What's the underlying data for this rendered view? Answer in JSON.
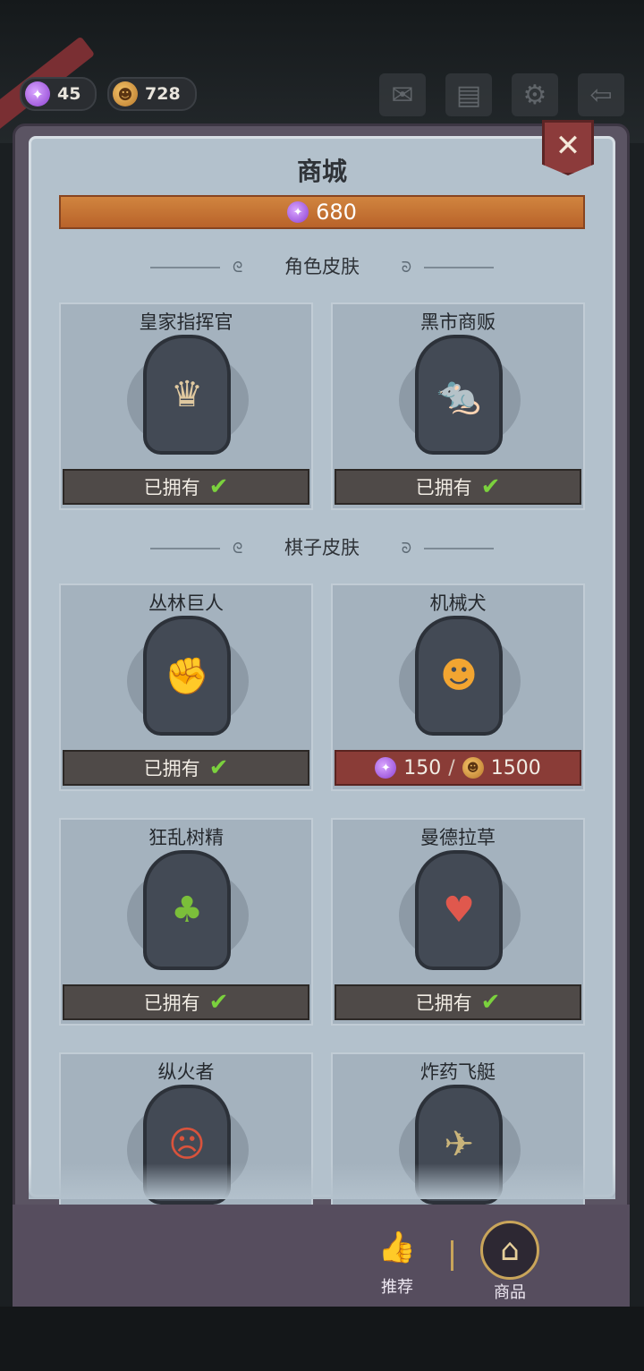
{
  "hud": {
    "candy_count": "45",
    "pumpkin_count": "728",
    "icons": [
      "helmet-icon",
      "mail-icon",
      "notes-icon",
      "gear-icon",
      "exit-icon"
    ]
  },
  "shop": {
    "title": "商城",
    "balance": "680",
    "close_icon": "close-icon"
  },
  "sections": [
    {
      "title": "角色皮肤",
      "items": [
        {
          "name": "皇家指挥官",
          "status": "已拥有",
          "portrait": "royal-commander-portrait"
        },
        {
          "name": "黑市商贩",
          "status": "已拥有",
          "portrait": "black-market-dealer-portrait"
        }
      ]
    },
    {
      "title": "棋子皮肤",
      "items": [
        {
          "name": "丛林巨人",
          "status": "已拥有",
          "portrait": "jungle-giant-portrait"
        },
        {
          "name": "机械犬",
          "price_candy": "150",
          "price_pumpkin": "1500",
          "portrait": "mech-dog-portrait"
        },
        {
          "name": "狂乱树精",
          "status": "已拥有",
          "portrait": "frenzy-treant-portrait"
        },
        {
          "name": "曼德拉草",
          "status": "已拥有",
          "portrait": "mandrake-portrait"
        },
        {
          "name": "纵火者",
          "portrait": "arsonist-portrait"
        },
        {
          "name": "炸药飞艇",
          "portrait": "bomb-airship-portrait"
        }
      ]
    }
  ],
  "nav": {
    "recommend": "推荐",
    "goods": "商品"
  },
  "colors": {
    "owned_check": "#7bd13d",
    "price_bg": "#8a3c37",
    "balance_bar": "#c97434"
  }
}
